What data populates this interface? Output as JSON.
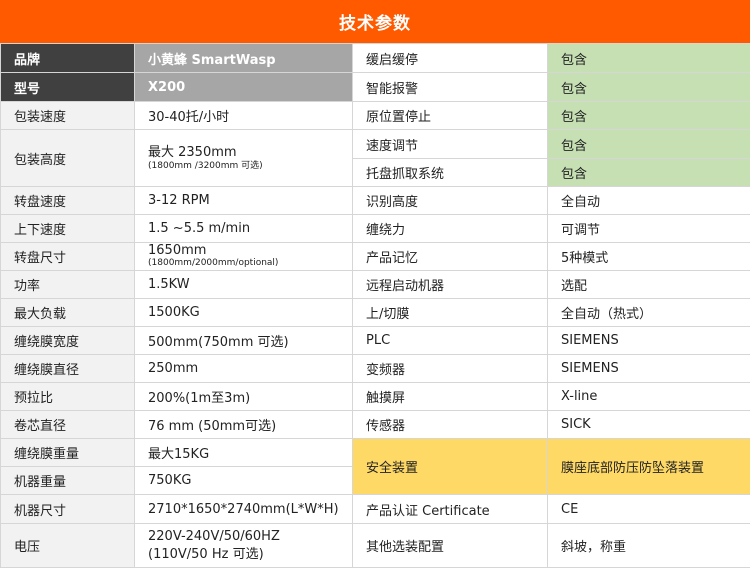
{
  "title": "技术参数",
  "rows": [
    {
      "l1": "品牌",
      "v1": "小黄蜂 SmartWasp",
      "l2": "缓启缓停",
      "v2": "包含"
    },
    {
      "l1": "型号",
      "v1": "X200",
      "l2": "智能报警",
      "v2": "包含"
    },
    {
      "l1": "包装速度",
      "v1": "30-40托/小时",
      "l2": "原位置停止",
      "v2": "包含"
    },
    {
      "l1": "包装高度",
      "v1": "最大 2350mm",
      "v1_sub": "(1800mm /3200mm 可选)",
      "l2a": "速度调节",
      "v2a": "包含",
      "l2b": "托盘抓取系统",
      "v2b": "包含"
    },
    {
      "l1": "转盘速度",
      "v1": "3-12 RPM",
      "l2": "识别高度",
      "v2": "全自动"
    },
    {
      "l1": "上下速度",
      "v1": "1.5 ~5.5 m/min",
      "l2": "缠绕力",
      "v2": "可调节"
    },
    {
      "l1": "转盘尺寸",
      "v1": "1650mm",
      "v1_sub": "(1800mm/2000mm/optional)",
      "l2": "产品记忆",
      "v2": "5种模式"
    },
    {
      "l1": "功率",
      "v1": "1.5KW",
      "l2": "远程启动机器",
      "v2": "选配"
    },
    {
      "l1": "最大负载",
      "v1": "1500KG",
      "l2": "上/切膜",
      "v2": "全自动（热式）"
    },
    {
      "l1": "缠绕膜宽度",
      "v1": "500mm(750mm 可选)",
      "l2": "PLC",
      "v2": "SIEMENS"
    },
    {
      "l1": "缠绕膜直径",
      "v1": "250mm",
      "l2": "变频器",
      "v2": "SIEMENS"
    },
    {
      "l1": "预拉比",
      "v1": "200%(1m至3m)",
      "l2": "触摸屏",
      "v2": "X-line"
    },
    {
      "l1": "卷芯直径",
      "v1": "76 mm (50mm可选)",
      "l2": "传感器",
      "v2": "SICK"
    },
    {
      "l1": "缠绕膜重量",
      "v1": "最大15KG",
      "l2": "安全装置",
      "v2": "膜座底部防压防坠落装置"
    },
    {
      "l1": "机器重量",
      "v1": "750KG"
    },
    {
      "l1": "机器尺寸",
      "v1": "2710*1650*2740mm(L*W*H)",
      "l2": "产品认证 Certificate",
      "v2": "CE"
    },
    {
      "l1": "电压",
      "v1": "220V-240V/50/60HZ",
      "v1_sub": "(110V/50 Hz 可选)",
      "l2": "其他选装配置",
      "v2": "斜坡，称重"
    }
  ]
}
